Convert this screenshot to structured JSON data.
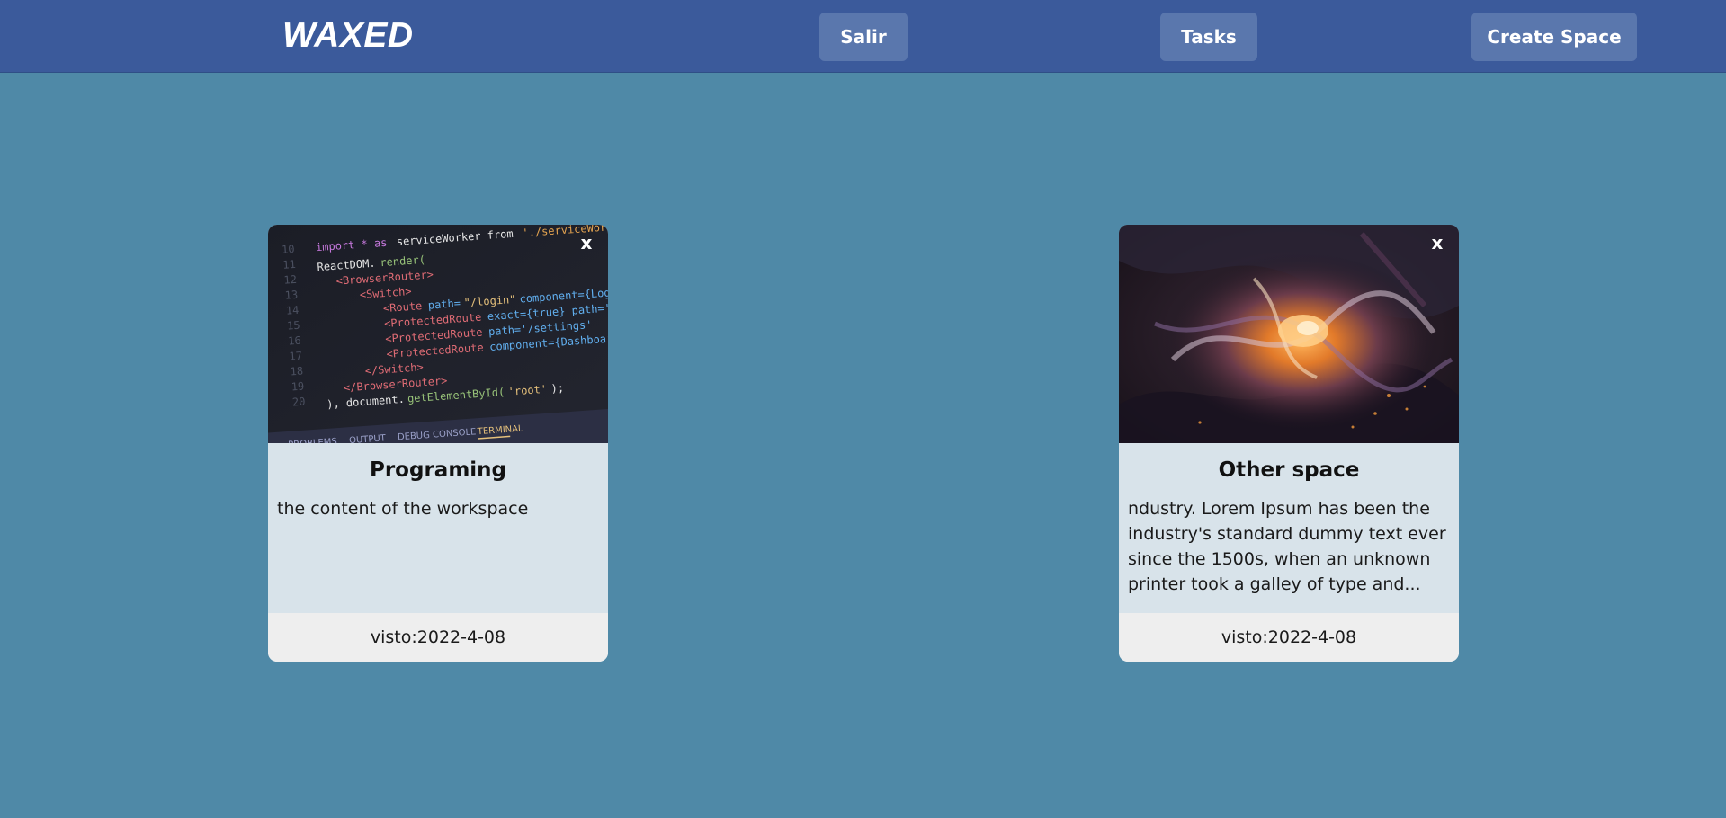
{
  "navbar": {
    "brand": "WAXED",
    "buttons": {
      "salir": "Salir",
      "tasks": "Tasks",
      "create_space": "Create Space"
    }
  },
  "cards": [
    {
      "title": "Programing",
      "content": "the content of the workspace",
      "visited": "visto:2022-4-08",
      "close_label": "x",
      "image": "code-editor-screenshot"
    },
    {
      "title": "Other space",
      "content": "ndustry. Lorem Ipsum has been the industry's standard dummy text ever since the 1500s, when an unknown printer took a galley of type and...",
      "visited": "visto:2022-4-08",
      "close_label": "x",
      "image": "abstract-fluid-art"
    }
  ],
  "colors": {
    "background": "#4f89a7",
    "navbar": "#3b5a9b",
    "nav_button": "#5a77ad",
    "card_body": "#d8e3ea",
    "card_footer": "#eeeeee"
  }
}
